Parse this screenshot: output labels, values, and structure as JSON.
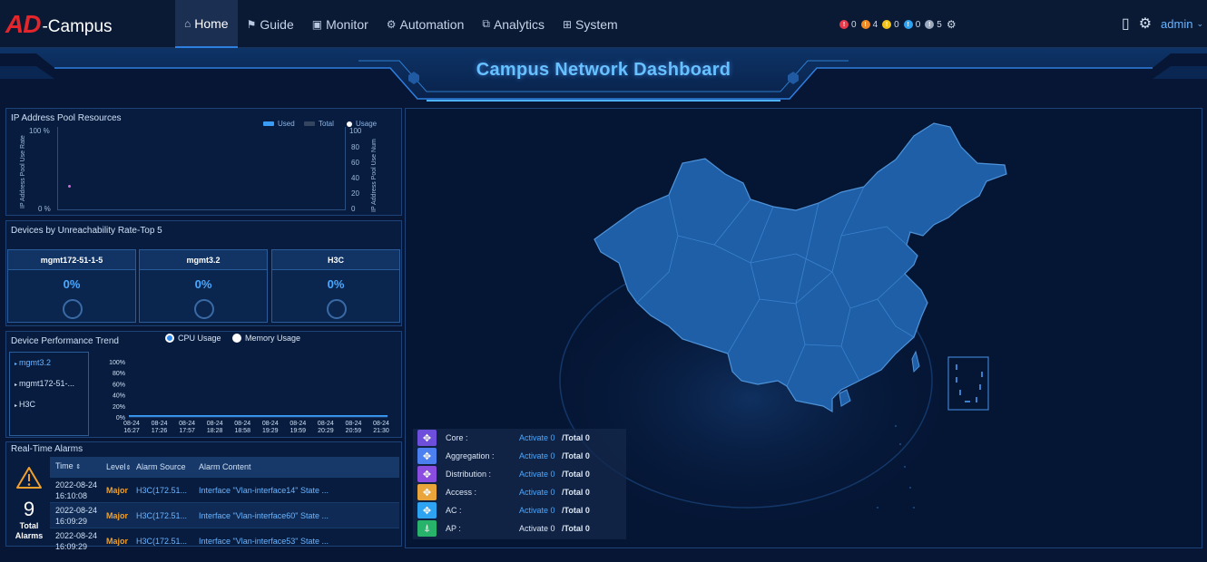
{
  "app": {
    "logo_ad": "AD",
    "logo_campus": "-Campus"
  },
  "nav": {
    "items": [
      {
        "label": "Home",
        "icon": "home-icon",
        "glyph": "⌂"
      },
      {
        "label": "Guide",
        "icon": "signpost-icon",
        "glyph": "⚑"
      },
      {
        "label": "Monitor",
        "icon": "monitor-icon",
        "glyph": "▣"
      },
      {
        "label": "Automation",
        "icon": "automation-icon",
        "glyph": "⚙"
      },
      {
        "label": "Analytics",
        "icon": "analytics-icon",
        "glyph": "⧉"
      },
      {
        "label": "System",
        "icon": "system-icon",
        "glyph": "⊞"
      }
    ],
    "active": "Home"
  },
  "alarm_counts": [
    {
      "color": "#e8394b",
      "value": "0"
    },
    {
      "color": "#f08a24",
      "value": "4"
    },
    {
      "color": "#f2c21b",
      "value": "0"
    },
    {
      "color": "#2ea3f2",
      "value": "0"
    },
    {
      "color": "#9aa9bd",
      "value": "5"
    }
  ],
  "user": {
    "name": "admin"
  },
  "dashboard": {
    "title": "Campus Network Dashboard"
  },
  "ip_pool": {
    "title": "IP Address Pool Resources",
    "legend": [
      "Used",
      "Total",
      "Usage"
    ],
    "left_axis_label": "IP Address Pool Use Rate",
    "right_axis_label": "IP Address Pool Use Num",
    "left_ticks": [
      "100 %",
      "0 %"
    ],
    "right_ticks": [
      "100",
      "80",
      "60",
      "40",
      "20",
      "0"
    ]
  },
  "unreachability": {
    "title": "Devices by Unreachability Rate-Top 5",
    "devices": [
      {
        "name": "mgmt172-51-1-5",
        "rate": "0%"
      },
      {
        "name": "mgmt3.2",
        "rate": "0%"
      },
      {
        "name": "H3C",
        "rate": "0%"
      }
    ]
  },
  "performance": {
    "title": "Device Performance Trend",
    "options": [
      "CPU Usage",
      "Memory Usage"
    ],
    "selected": "CPU Usage",
    "devices": [
      "mgmt3.2",
      "mgmt172-51-...",
      "H3C"
    ],
    "selected_device": "mgmt3.2",
    "chart_data": {
      "type": "line",
      "title": "",
      "ylabel": "",
      "xlabel": "",
      "ylim": [
        0,
        100
      ],
      "y_ticks": [
        "100%",
        "80%",
        "60%",
        "40%",
        "20%",
        "0%"
      ],
      "x_ticks": [
        [
          "08-24",
          "16:27"
        ],
        [
          "08-24",
          "17:26"
        ],
        [
          "08-24",
          "17:57"
        ],
        [
          "08-24",
          "18:28"
        ],
        [
          "08-24",
          "18:58"
        ],
        [
          "08-24",
          "19:29"
        ],
        [
          "08-24",
          "19:59"
        ],
        [
          "08-24",
          "20:29"
        ],
        [
          "08-24",
          "20:59"
        ],
        [
          "08-24",
          "21:30"
        ]
      ],
      "series": [
        {
          "values": [
            2,
            2,
            2,
            2,
            2,
            2,
            2,
            2,
            2,
            2,
            2,
            2,
            2,
            2,
            2,
            2,
            2,
            2,
            2,
            2,
            2,
            2,
            2,
            2,
            2,
            2,
            2,
            2,
            2,
            2,
            2,
            2,
            2,
            2,
            2,
            2,
            2,
            2,
            2,
            2
          ]
        }
      ]
    }
  },
  "alarms": {
    "title": "Real-Time Alarms",
    "total": "9",
    "total_label_1": "Total",
    "total_label_2": "Alarms",
    "columns": [
      "Time",
      "Level",
      "Alarm Source",
      "Alarm Content"
    ],
    "rows": [
      {
        "date": "2022-08-24",
        "time": "16:10:08",
        "level": "Major",
        "source": "H3C(172.51...",
        "content": "Interface \"Vlan-interface14\" State ..."
      },
      {
        "date": "2022-08-24",
        "time": "16:09:29",
        "level": "Major",
        "source": "H3C(172.51...",
        "content": "Interface \"Vlan-interface60\" State ..."
      },
      {
        "date": "2022-08-24",
        "time": "16:09:29",
        "level": "Major",
        "source": "H3C(172.51...",
        "content": "Interface \"Vlan-interface53\" State ..."
      }
    ]
  },
  "device_types": [
    {
      "name": "Core :",
      "icon": "core-switch-icon",
      "color": "#6d4fdc",
      "activate": "Activate 0",
      "total": "/Total 0"
    },
    {
      "name": "Aggregation :",
      "icon": "aggregation-switch-icon",
      "color": "#4c7ff0",
      "activate": "Activate 0",
      "total": "/Total 0"
    },
    {
      "name": "Distribution :",
      "icon": "distribution-switch-icon",
      "color": "#8a4de0",
      "activate": "Activate 0",
      "total": "/Total 0"
    },
    {
      "name": "Access :",
      "icon": "access-switch-icon",
      "color": "#e9a53a",
      "activate": "Activate 0",
      "total": "/Total 0"
    },
    {
      "name": "AC :",
      "icon": "ac-controller-icon",
      "color": "#2ea3f2",
      "activate": "Activate 0",
      "total": "/Total 0"
    },
    {
      "name": "AP :",
      "icon": "access-point-icon",
      "color": "#27b36a",
      "activate": "Activate 0",
      "total": "/Total 0"
    }
  ],
  "colors": {
    "accent": "#2f8bf0",
    "map_fill": "#1e5fa8",
    "map_stroke": "#4e93d9",
    "major": "#f0a12c"
  }
}
